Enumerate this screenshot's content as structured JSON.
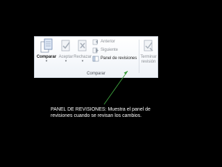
{
  "ribbon": {
    "buttons": {
      "comparar": "Comparar",
      "aceptar": "Aceptar",
      "rechazar": "Rechazar",
      "terminar_line1": "Terminar",
      "terminar_line2": "revisión"
    },
    "small_items": {
      "anterior": "Anterior",
      "siguiente": "Siguiente",
      "panel": "Panel de revisiones"
    },
    "group_label": "Comparar",
    "dropdown_marker": "▾"
  },
  "callout": {
    "text": "PANEL DE REVISIONES: Muestra el panel de revisiones cuando se revisan los cambios."
  },
  "colors": {
    "background": "#000000",
    "arrow": "#3a9a3a",
    "callout_text": "#ffffff"
  }
}
